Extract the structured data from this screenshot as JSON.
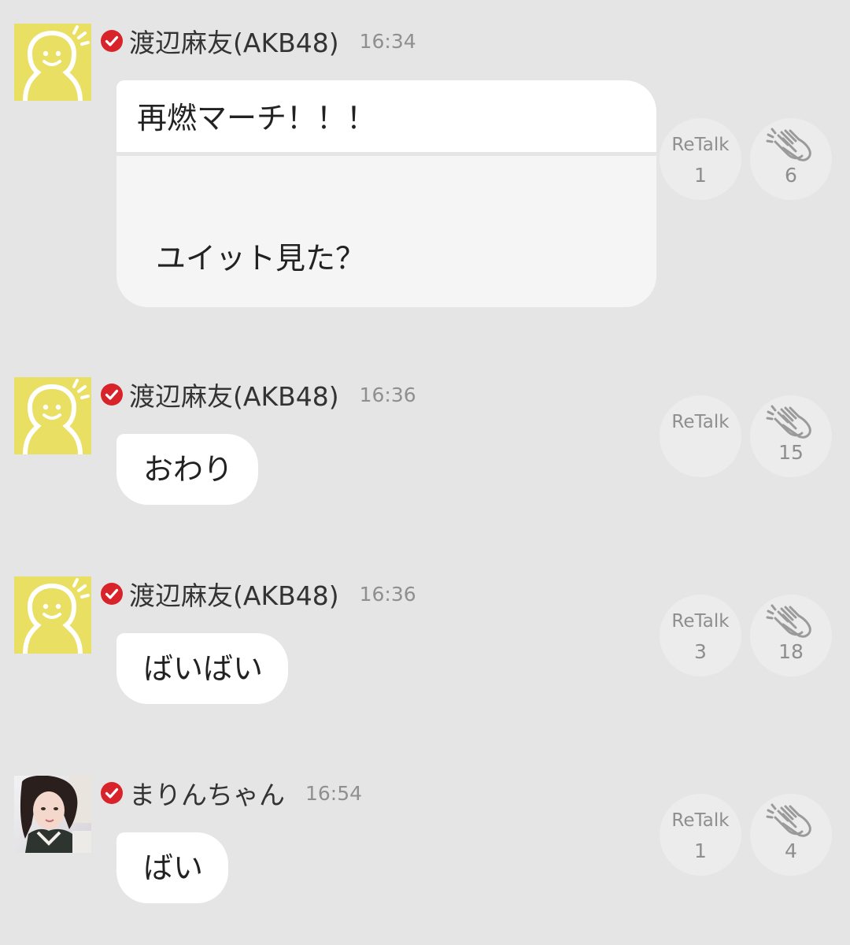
{
  "messages": [
    {
      "name": "渡辺麻友(AKB48)",
      "time": "16:34",
      "text_top": "再燃マーチ！！！",
      "text_bottom": "ユイット見た？",
      "retalk_label": "ReTalk",
      "retalk_count": "1",
      "clap_count": "6"
    },
    {
      "name": "渡辺麻友(AKB48)",
      "time": "16:36",
      "text": "おわり",
      "retalk_label": "ReTalk",
      "retalk_count": "",
      "clap_count": "15"
    },
    {
      "name": "渡辺麻友(AKB48)",
      "time": "16:36",
      "text": "ばいばい",
      "retalk_label": "ReTalk",
      "retalk_count": "3",
      "clap_count": "18"
    },
    {
      "name": "まりんちゃん",
      "time": "16:54",
      "text": "ばい",
      "retalk_label": "ReTalk",
      "retalk_count": "1",
      "clap_count": "4"
    }
  ],
  "icons": {
    "verified": "verified-check-icon",
    "default_avatar": "default-avatar-icon",
    "clap": "clap-icon"
  },
  "colors": {
    "background": "#e5e5e5",
    "bubble": "#ffffff",
    "avatar_yellow": "#e9df62",
    "verified_red": "#d9232a",
    "muted_text": "#8e8e8e"
  }
}
